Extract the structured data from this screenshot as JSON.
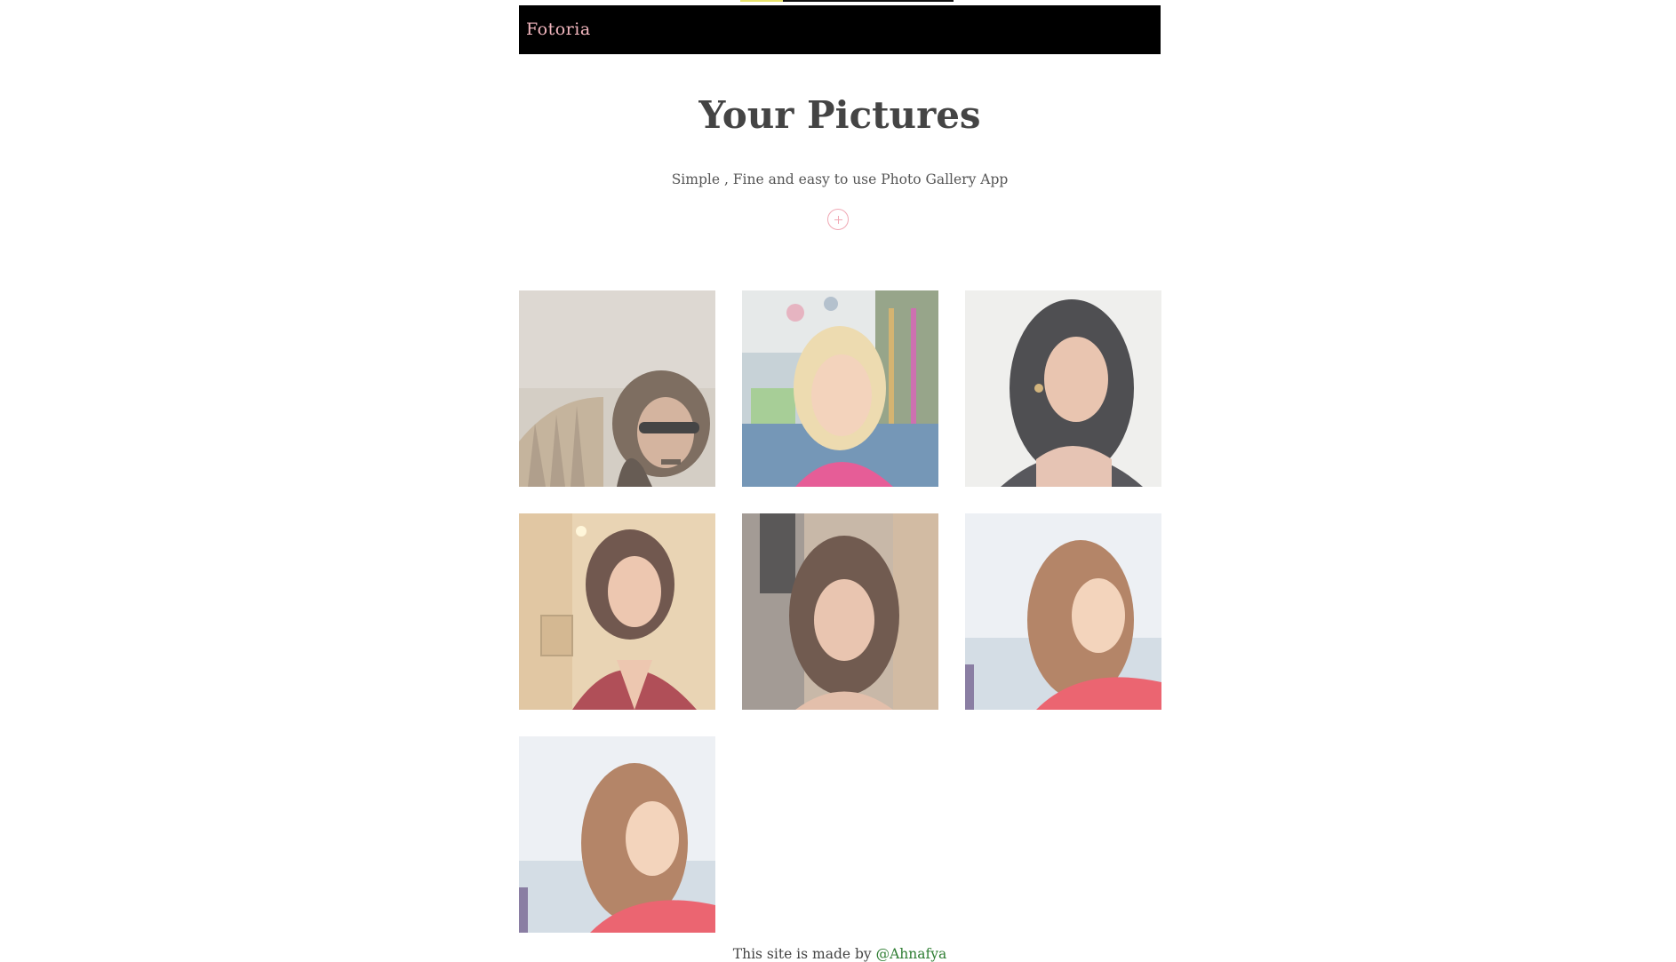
{
  "navbar": {
    "brand": "Fotoria"
  },
  "header": {
    "title": "Your Pictures",
    "subtitle": "Simple , Fine and easy to use Photo Gallery App",
    "add_icon": "plus-circle-icon"
  },
  "gallery": {
    "photos": [
      {
        "name": "photo-1"
      },
      {
        "name": "photo-2"
      },
      {
        "name": "photo-3"
      },
      {
        "name": "photo-4"
      },
      {
        "name": "photo-5"
      },
      {
        "name": "photo-6"
      },
      {
        "name": "photo-7"
      }
    ]
  },
  "footer": {
    "text": "This site is made by ",
    "link": "@Ahnafya"
  },
  "colors": {
    "navbar_bg": "#000000",
    "brand": "#f4b8c0",
    "heading": "#444444",
    "accent": "#f0a8b4",
    "link": "#2e7d32"
  }
}
